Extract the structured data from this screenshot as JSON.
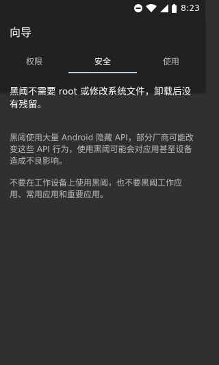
{
  "status_bar": {
    "time": "8:23",
    "icons": [
      "do-not-disturb-icon",
      "wifi-icon",
      "signal-icon",
      "battery-icon"
    ]
  },
  "header": {
    "title": "向导"
  },
  "tabs": [
    {
      "label": "权限",
      "active": false
    },
    {
      "label": "安全",
      "active": true
    },
    {
      "label": "使用",
      "active": false
    }
  ],
  "content": {
    "heading": "黑阈不需要 root 或修改系统文件，卸载后没有残留。",
    "paragraphs": [
      "黑阈使用大量 Android 隐藏 API，部分厂商可能改变这些 API 行为，使用黑阈可能会对应用甚至设备造成不良影响。",
      "不要在工作设备上使用黑阈，也不要黑阈工作应用、常用应用和重要应用。"
    ]
  },
  "colors": {
    "background": "#303030",
    "app_bar": "#212121",
    "tab_indicator": "#b8cfe6",
    "text_primary": "#ffffff",
    "text_secondary": "#bcbcbc"
  }
}
